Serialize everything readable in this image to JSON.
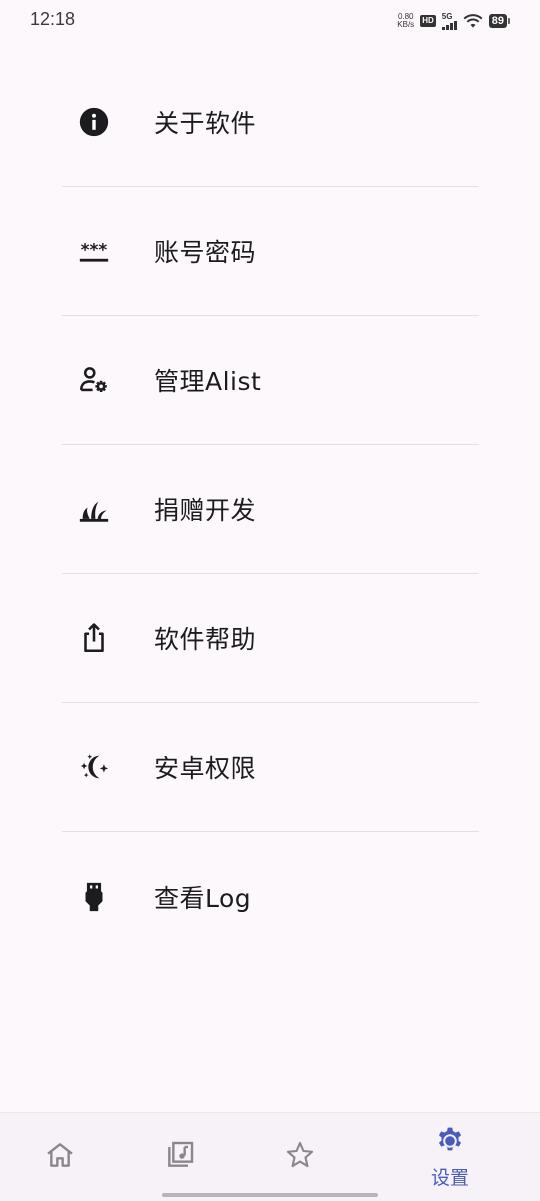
{
  "status": {
    "time": "12:18",
    "net_speed_value": "0.80",
    "net_speed_unit": "KB/s",
    "hd_badge": "HD",
    "network": "5G",
    "battery": "89"
  },
  "menu": {
    "items": [
      {
        "label": "关于软件",
        "icon": "info-icon"
      },
      {
        "label": "账号密码",
        "icon": "password-icon"
      },
      {
        "label": "管理Alist",
        "icon": "manage-accounts-icon"
      },
      {
        "label": "捐赠开发",
        "icon": "grass-icon"
      },
      {
        "label": "软件帮助",
        "icon": "share-icon"
      },
      {
        "label": "安卓权限",
        "icon": "night-sight-icon"
      },
      {
        "label": "查看Log",
        "icon": "usb-plug-icon"
      }
    ]
  },
  "bottom_nav": {
    "items": [
      {
        "label": "",
        "icon": "home-icon",
        "active": false
      },
      {
        "label": "",
        "icon": "music-library-icon",
        "active": false
      },
      {
        "label": "",
        "icon": "star-icon",
        "active": false
      },
      {
        "label": "设置",
        "icon": "settings-icon",
        "active": true
      }
    ],
    "active_color": "#4a5bbd",
    "inactive_color": "#8a878b"
  }
}
